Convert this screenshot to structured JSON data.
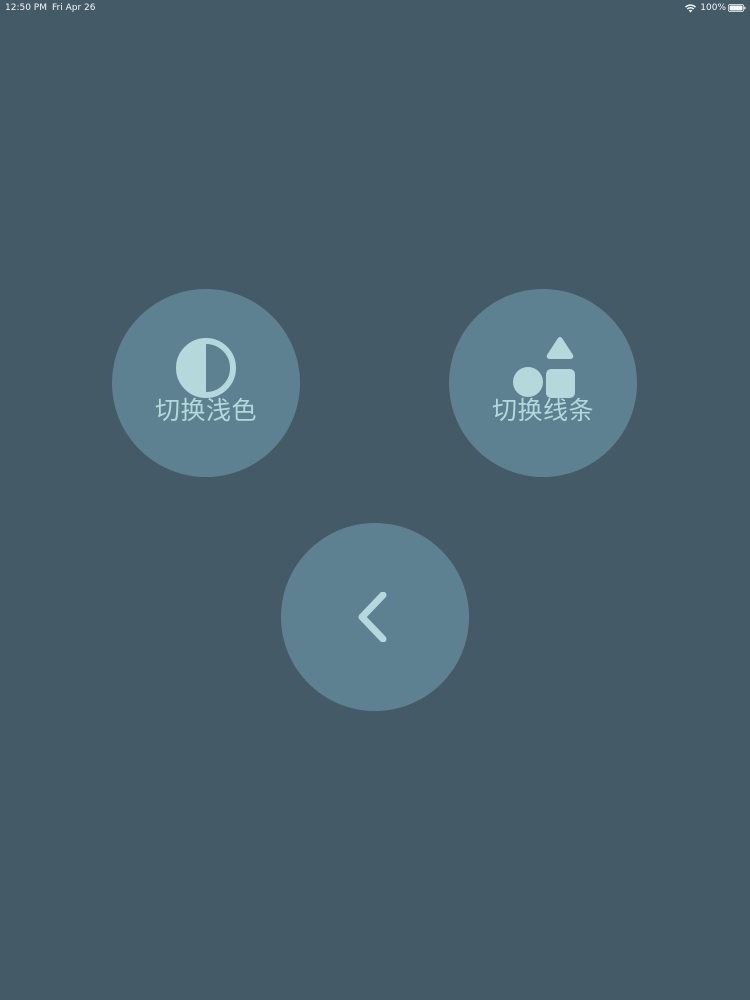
{
  "status_bar": {
    "time": "12:50 PM",
    "date": "Fri Apr 26",
    "battery": "100%",
    "wifi_icon": "wifi-icon",
    "battery_icon": "battery-icon"
  },
  "buttons": {
    "toggle_light": {
      "label": "切换浅色",
      "icon": "contrast-icon"
    },
    "toggle_lines": {
      "label": "切换线条",
      "icon": "shapes-icon"
    },
    "back": {
      "icon": "chevron-left-icon"
    }
  },
  "colors": {
    "background": "#455a67",
    "button": "#5e8192",
    "foreground": "#b5d8dc"
  }
}
